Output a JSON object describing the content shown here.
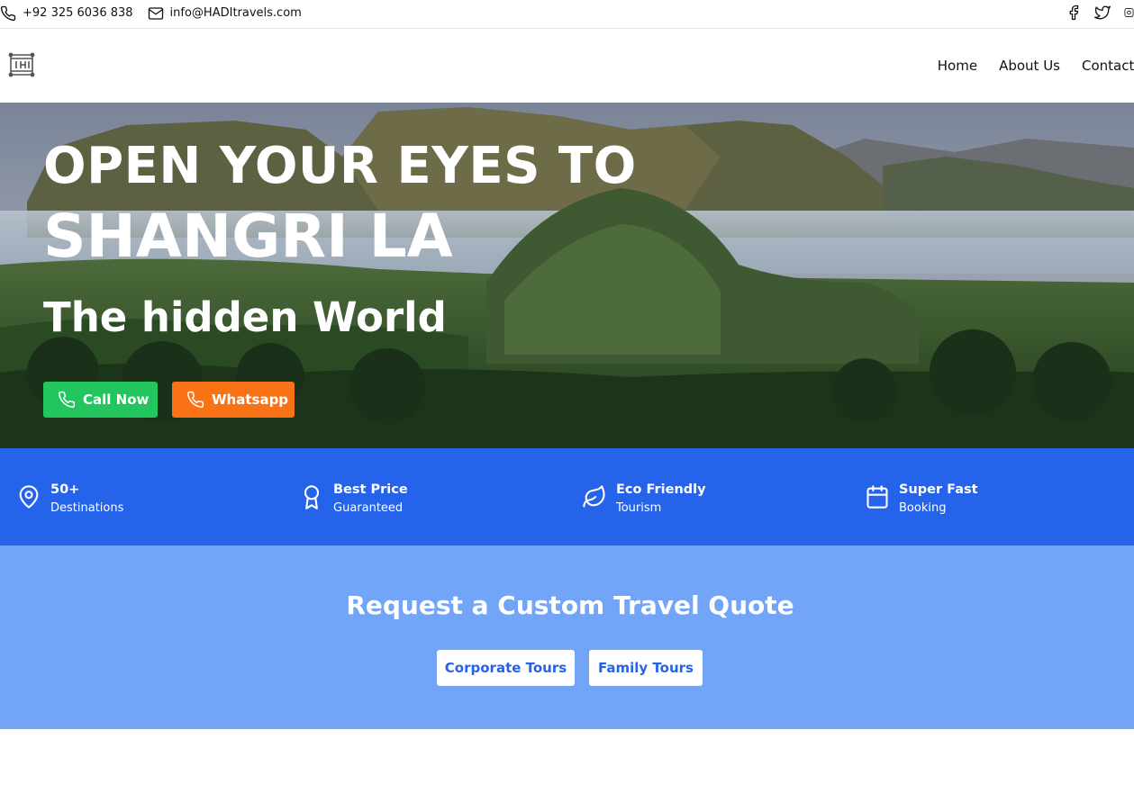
{
  "topbar": {
    "phone": "+92 325 6036 838",
    "email": "info@HADItravels.com",
    "icons": [
      "phone-icon",
      "mail-icon",
      "facebook-icon",
      "twitter-icon",
      "instagram-icon"
    ]
  },
  "header": {
    "logo_icon": "hadi-logo-icon",
    "nav": {
      "home": "Home",
      "about": "About Us",
      "contact": "Contact"
    }
  },
  "hero": {
    "line1": "OPEN YOUR EYES TO",
    "line2": "SHANGRI LA",
    "line3": "The hidden World",
    "call_label": "Call Now",
    "whatsapp_label": "Whatsapp",
    "colors": {
      "call": "#22c55e",
      "whatsapp": "#f97316"
    }
  },
  "features": [
    {
      "icon": "map-pin-icon",
      "title": "50+",
      "subtitle": "Destinations"
    },
    {
      "icon": "award-icon",
      "title": "Best Price",
      "subtitle": "Guaranteed"
    },
    {
      "icon": "leaf-icon",
      "title": "Eco Friendly",
      "subtitle": "Tourism"
    },
    {
      "icon": "calendar-icon",
      "title": "Super Fast",
      "subtitle": "Booking"
    }
  ],
  "quote": {
    "title": "Request a Custom Travel Quote",
    "corporate_label": "Corporate Tours",
    "family_label": "Family Tours"
  },
  "colors": {
    "accent_blue": "#2563eb",
    "quote_bg": "#72a4f7"
  }
}
